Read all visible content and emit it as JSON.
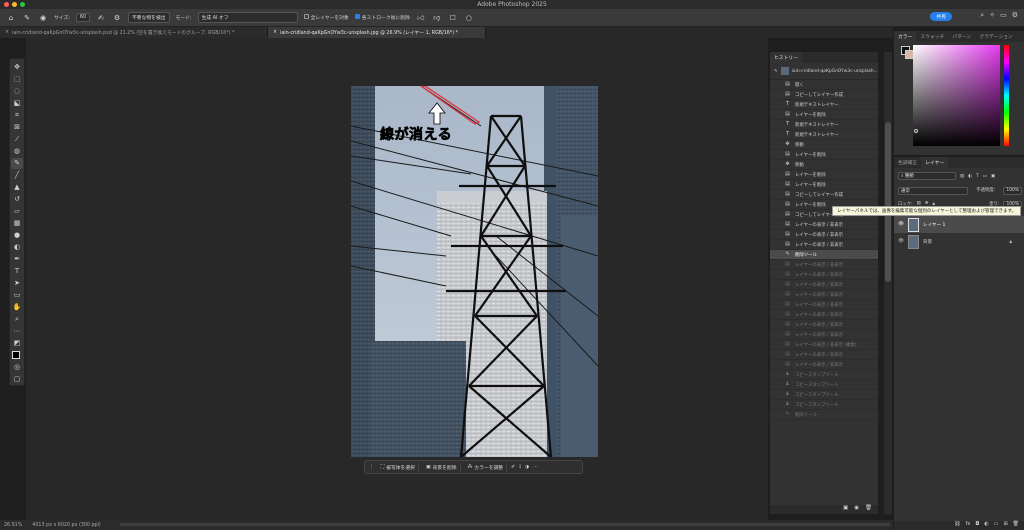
{
  "app": {
    "title": "Adobe Photoshop 2025"
  },
  "options": {
    "size_label": "サイズ:",
    "size_value": "60",
    "sample_label": "不要な物を検出",
    "mode_label": "モード:",
    "mode_value": "生成 AI オフ",
    "all_layers_label": "全レイヤーを対象",
    "each_stroke_label": "各ストローク後に削除",
    "share_label": "共有"
  },
  "tabs": [
    {
      "label": "iain-cridland-qaKpGnOYw3c-unsplash.psd @ 21.2% (空を置き換えモードのグループ, RGB/16*) *"
    },
    {
      "label": "iain-cridland-qaKpGnOYw3c-unsplash.jpg @ 26.9% (レイヤー 1, RGB/16*) *"
    }
  ],
  "canvas": {
    "annotation": "線が消える"
  },
  "context_bar": {
    "select_subject": "被写体を選択",
    "remove_bg": "背景を削除",
    "adjust_color": "カラーを調整"
  },
  "status": {
    "zoom": "26.91%",
    "doc_info": "4013 px x 6020 px (300 ppi)"
  },
  "history": {
    "tab_label": "ヒストリー",
    "snapshot": "iain-cridland-qaKpGnOYw3c-unsplash...",
    "items": [
      {
        "label": "開く",
        "icon": "open-icon",
        "state": "active"
      },
      {
        "label": "コピーしてレイヤー作成",
        "icon": "layer-icon",
        "state": "active"
      },
      {
        "label": "新規テキストレイヤー",
        "icon": "text-icon",
        "state": "active"
      },
      {
        "label": "レイヤーを削除",
        "icon": "layer-icon",
        "state": "active"
      },
      {
        "label": "新規テキストレイヤー",
        "icon": "text-icon",
        "state": "active"
      },
      {
        "label": "新規テキストレイヤー",
        "icon": "text-icon",
        "state": "active"
      },
      {
        "label": "移動",
        "icon": "move-icon",
        "state": "active"
      },
      {
        "label": "レイヤーを削除",
        "icon": "layer-icon",
        "state": "active"
      },
      {
        "label": "移動",
        "icon": "move-icon",
        "state": "active"
      },
      {
        "label": "レイヤーを削除",
        "icon": "layer-icon",
        "state": "active"
      },
      {
        "label": "レイヤーを削除",
        "icon": "layer-icon",
        "state": "active"
      },
      {
        "label": "コピーしてレイヤー作成",
        "icon": "layer-icon",
        "state": "active"
      },
      {
        "label": "レイヤーを削除",
        "icon": "layer-icon",
        "state": "active"
      },
      {
        "label": "コピーしてレイヤー作成",
        "icon": "layer-icon",
        "state": "active"
      },
      {
        "label": "レイヤーの表示 / 非表示",
        "icon": "layer-icon",
        "state": "active"
      },
      {
        "label": "レイヤーの表示 / 非表示",
        "icon": "layer-icon",
        "state": "active"
      },
      {
        "label": "レイヤーの表示 / 非表示",
        "icon": "layer-icon",
        "state": "active"
      },
      {
        "label": "削除ツール",
        "icon": "brush-icon",
        "state": "current"
      },
      {
        "label": "レイヤーの表示 / 非表示",
        "icon": "layer-icon",
        "state": "dim"
      },
      {
        "label": "レイヤーの表示 / 非表示",
        "icon": "layer-icon",
        "state": "dim"
      },
      {
        "label": "レイヤーの表示 / 非表示",
        "icon": "layer-icon",
        "state": "dim"
      },
      {
        "label": "レイヤーの表示 / 非表示",
        "icon": "layer-icon",
        "state": "dim"
      },
      {
        "label": "レイヤーの表示 / 非表示",
        "icon": "layer-icon",
        "state": "dim"
      },
      {
        "label": "レイヤーの表示 / 非表示",
        "icon": "layer-icon",
        "state": "dim"
      },
      {
        "label": "レイヤーの表示 / 非表示",
        "icon": "layer-icon",
        "state": "dim"
      },
      {
        "label": "レイヤーの表示 / 非表示",
        "icon": "layer-icon",
        "state": "dim"
      },
      {
        "label": "レイヤーの表示 / 非表示 (複数)",
        "icon": "layer-icon",
        "state": "dim"
      },
      {
        "label": "レイヤーの表示 / 非表示",
        "icon": "layer-icon",
        "state": "dim"
      },
      {
        "label": "レイヤーの表示 / 非表示",
        "icon": "layer-icon",
        "state": "dim"
      },
      {
        "label": "コピースタンプツール",
        "icon": "stamp-icon",
        "state": "dim"
      },
      {
        "label": "コピースタンプツール",
        "icon": "stamp-icon",
        "state": "dim"
      },
      {
        "label": "コピースタンプツール",
        "icon": "stamp-icon",
        "state": "dim"
      },
      {
        "label": "コピースタンプツール",
        "icon": "stamp-icon",
        "state": "dim"
      },
      {
        "label": "削除ツール",
        "icon": "brush-icon",
        "state": "dim"
      }
    ]
  },
  "color_panel": {
    "tabs": [
      "カラー",
      "スウォッチ",
      "パターン",
      "グラデーション"
    ]
  },
  "layers_panel": {
    "tabs": [
      "色調補正",
      "レイヤー"
    ],
    "filter_label": "種類",
    "blend_mode": "通常",
    "opacity_label": "不透明度:",
    "opacity_value": "100%",
    "lock_label": "ロック:",
    "fill_label": "塗り:",
    "fill_value": "100%",
    "layers": [
      {
        "name": "レイヤー 1",
        "selected": true
      },
      {
        "name": "背景",
        "selected": false,
        "locked": true
      }
    ]
  },
  "tooltip": "レイヤーパネルでは、画像を編集可能な個別のレイヤーとして整理および管理できます。"
}
